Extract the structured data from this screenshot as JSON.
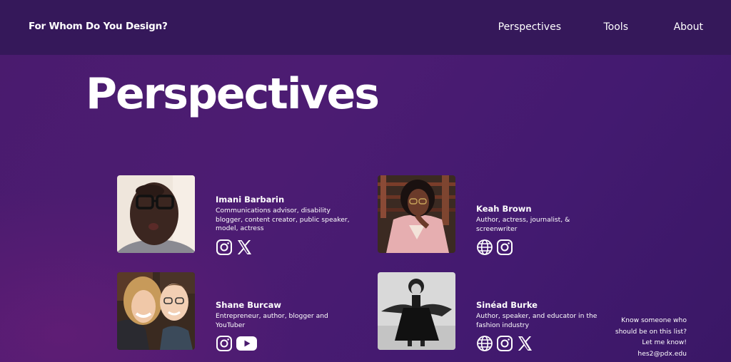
{
  "header": {
    "site_title": "For Whom Do You Design?",
    "nav": [
      "Perspectives",
      "Tools",
      "About"
    ]
  },
  "page": {
    "title": "Perspectives"
  },
  "people": [
    {
      "name": "Imani Barbarin",
      "description": "Communications advisor, disability blogger, content creator, public speaker, model, actress",
      "icons": [
        "instagram-icon",
        "x-icon"
      ]
    },
    {
      "name": "Keah Brown",
      "description": "Author, actress, journalist, & screenwriter",
      "icons": [
        "globe-icon",
        "instagram-icon"
      ]
    },
    {
      "name": "Shane Burcaw",
      "description": "Entrepreneur, author, blogger and YouTuber",
      "icons": [
        "instagram-icon",
        "youtube-icon"
      ]
    },
    {
      "name": "Sinéad Burke",
      "description": "Author, speaker, and educator in the fashion industry",
      "icons": [
        "globe-icon",
        "instagram-icon",
        "x-icon"
      ]
    }
  ],
  "contact": {
    "line1": "Know someone who",
    "line2": "should be on this list?",
    "line3": "Let me know!",
    "email": "hes2@pdx.edu"
  },
  "colors": {
    "topbar": "#35185a",
    "background": "#4a1b6e",
    "text": "#ffffff"
  }
}
